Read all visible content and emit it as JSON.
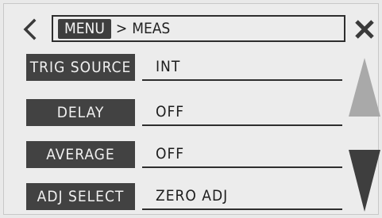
{
  "header": {
    "menu_label": "MENU",
    "separator": ">",
    "current": "MEAS"
  },
  "rows": [
    {
      "label": "TRIG SOURCE",
      "value": "INT"
    },
    {
      "label": "DELAY",
      "value": "OFF"
    },
    {
      "label": "AVERAGE",
      "value": "OFF"
    },
    {
      "label": "ADJ SELECT",
      "value": "ZERO ADJ"
    }
  ],
  "icons": {
    "back": "chevron-left-icon",
    "close": "close-icon",
    "scroll_up": "triangle-up-icon",
    "scroll_down": "triangle-down-icon"
  },
  "colors": {
    "label_bg": "#424242",
    "scroll_up_enabled": "#a9a9a9",
    "scroll_down_enabled": "#3e3e3e"
  }
}
